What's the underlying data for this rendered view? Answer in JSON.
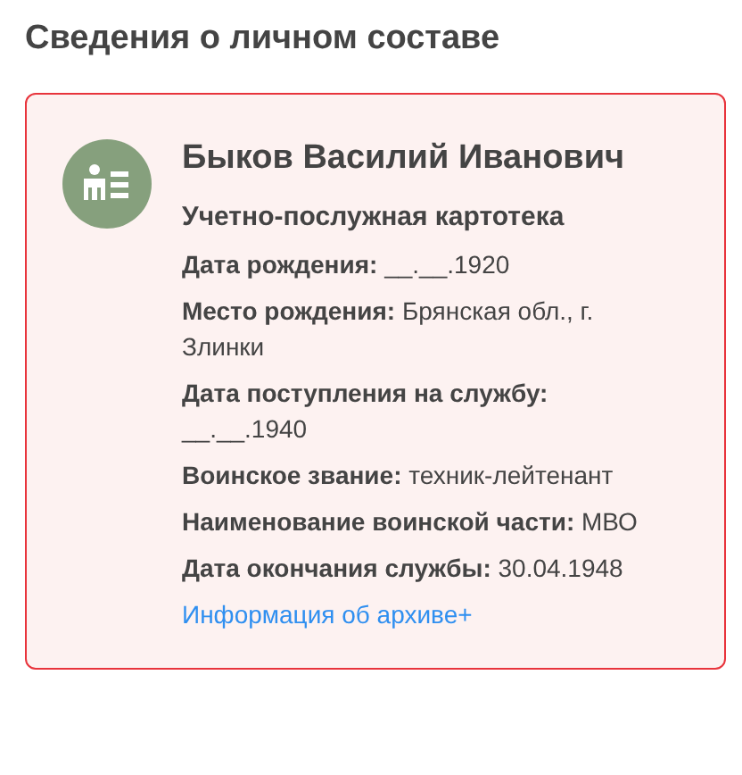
{
  "title": "Сведения о личном составе",
  "card": {
    "name": "Быков Василий Иванович",
    "subtitle": "Учетно-послужная картотека",
    "fields": [
      "**Дата рождения:** __.__.1920",
      "**Место рождения:** Брянская обл., г. Злинки",
      "**Дата поступления на службу:** __.__.1940",
      "**Воинское звание:** техник-лейтенант",
      "**Наименование воинской части:** МВО",
      "**Дата окончания службы:** 30.04.1948"
    ],
    "link": "Информация об архиве+"
  }
}
